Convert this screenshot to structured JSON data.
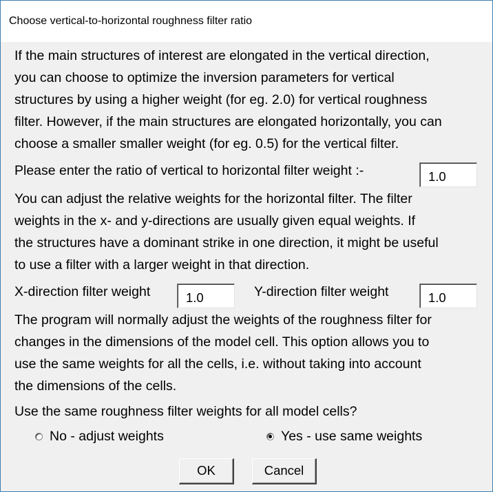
{
  "window": {
    "title": "Choose vertical-to-horizontal roughness filter ratio"
  },
  "intro": {
    "lines": [
      "If the main structures of interest are elongated in the vertical direction,",
      "you can choose to optimize the inversion parameters for vertical",
      "structures by using a higher weight (for eg. 2.0) for vertical roughness",
      "filter. However, if the main structures are elongated horizontally, you can",
      "choose a smaller smaller weight (for eg. 0.5) for the vertical filter."
    ]
  },
  "ratio": {
    "label": "Please enter the ratio of vertical to horizontal filter weight :-",
    "value": "1.0"
  },
  "horizontal_info": {
    "lines": [
      "You can adjust the relative weights for the horizontal filter. The filter",
      "weights in the x- and y-directions are usually given equal weights. If",
      "the structures have a dominant strike in one direction, it might be useful",
      "to use a filter with a larger weight in that direction."
    ]
  },
  "x_weight": {
    "label": "X-direction filter weight",
    "value": "1.0"
  },
  "y_weight": {
    "label": "Y-direction filter weight",
    "value": "1.0"
  },
  "cells_info": {
    "lines": [
      "The program will normally adjust the weights of the roughness filter for",
      "changes in the dimensions of the model cell. This option allows you to",
      "use the same weights for all the cells, i.e. without taking into account",
      "the dimensions of the cells."
    ]
  },
  "question": "Use the same roughness filter weights for all model cells?",
  "options": {
    "no": {
      "label": "No - adjust weights",
      "checked": false
    },
    "yes": {
      "label": "Yes - use same weights",
      "checked": true
    }
  },
  "buttons": {
    "ok": "OK",
    "cancel": "Cancel"
  }
}
